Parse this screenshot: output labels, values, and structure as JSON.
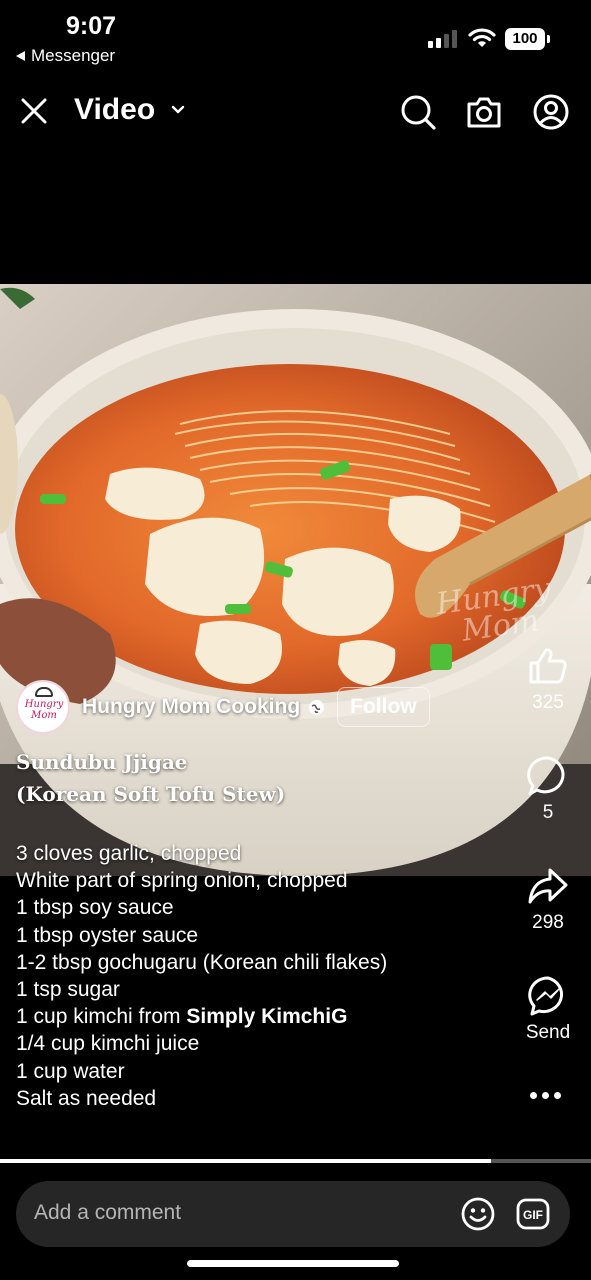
{
  "status_bar": {
    "time": "9:07",
    "back_app": "Messenger",
    "battery": "100"
  },
  "header": {
    "title": "Video",
    "icons": [
      "close-icon",
      "chevron-down-icon",
      "search-icon",
      "camera-icon",
      "profile-icon"
    ]
  },
  "video": {
    "watermark_line1": "Hungry",
    "watermark_line2": "Mom",
    "progress_fraction": 0.83
  },
  "author": {
    "logo_text": "Hungry Mom",
    "name": "Hungry Mom Cooking",
    "follow_label": "Follow"
  },
  "caption": {
    "title_line1": "Sundubu Jjigae",
    "title_line2": "(Korean Soft Tofu Stew)",
    "ingredients": [
      "3 cloves garlic, chopped",
      "White part of spring onion, chopped",
      "1 tbsp soy sauce",
      "1 tbsp oyster sauce",
      "1-2 tbsp gochugaru (Korean chili flakes)",
      "1 tsp sugar"
    ],
    "kimchi_prefix": "1 cup kimchi from ",
    "kimchi_brand": "Simply KimchiG",
    "ingredients_after": [
      "1/4 cup kimchi juice",
      "1 cup water",
      "Salt as needed"
    ]
  },
  "actions": {
    "likes": "325",
    "comments": "5",
    "shares": "298",
    "send_label": "Send"
  },
  "comment_bar": {
    "placeholder": "Add a comment"
  },
  "colors": {
    "background": "#000000",
    "comment_bar": "#262626",
    "stew": "#e0742a"
  }
}
